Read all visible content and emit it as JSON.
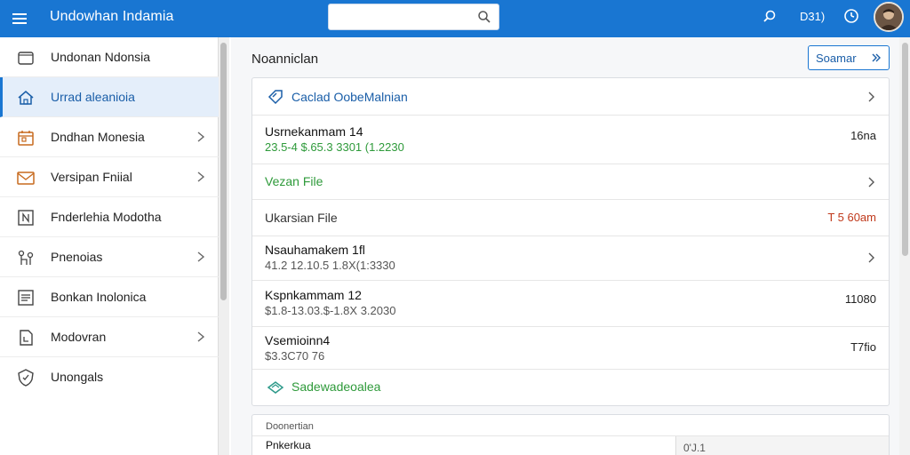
{
  "header": {
    "app_title": "Undowhan Indamia",
    "search_placeholder": "",
    "code": "D31)",
    "colors": {
      "bar": "#1976d2"
    }
  },
  "sidebar": {
    "items": [
      {
        "label": "Undonan Ndonsia",
        "icon": "folder-icon",
        "chevron": false,
        "active": false
      },
      {
        "label": "Urrad aleanioia",
        "icon": "home-icon",
        "chevron": false,
        "active": true
      },
      {
        "label": "Dndhan Monesia",
        "icon": "calendar-icon",
        "chevron": true,
        "active": false
      },
      {
        "label": "Versipan Fniial",
        "icon": "mail-icon",
        "chevron": true,
        "active": false
      },
      {
        "label": "Fnderlehia Modotha",
        "icon": "document-icon",
        "chevron": false,
        "active": false
      },
      {
        "label": "Pnenoias",
        "icon": "network-icon",
        "chevron": true,
        "active": false
      },
      {
        "label": "Bonkan Inolonica",
        "icon": "list-icon",
        "chevron": false,
        "active": false
      },
      {
        "label": "Modovran",
        "icon": "file-icon",
        "chevron": true,
        "active": false
      },
      {
        "label": "Unongals",
        "icon": "shield-icon",
        "chevron": false,
        "active": false
      }
    ]
  },
  "main": {
    "page_title": "Noanniclan",
    "primary_button": "Soamar",
    "card": {
      "header_link": "Caclad OobeMalnian",
      "rows": [
        {
          "title": "Usrnekanmam 14",
          "sub": "23.5-4 $.65.3 3301 (1.2230",
          "right": "16na"
        },
        {
          "link": "Vezan File"
        },
        {
          "label": "Ukarsian File",
          "right": "T 5 60am"
        },
        {
          "title": "Nsauhamakem 1fl",
          "sub": "41.2 12.10.5 1.8X(1:3330"
        },
        {
          "title": "Kspnkammam 12",
          "sub": "$1.8-13.03.$-1.8X 3.2030",
          "right": "11080"
        },
        {
          "title": "Vsemioinn4",
          "sub": "$3.3C70 76",
          "right": "T7fio"
        }
      ],
      "footer_link": "Sadewadeoalea"
    },
    "card2": {
      "header": "Doonertian",
      "field": "Pnkerkua",
      "value": "0'J.1"
    }
  }
}
